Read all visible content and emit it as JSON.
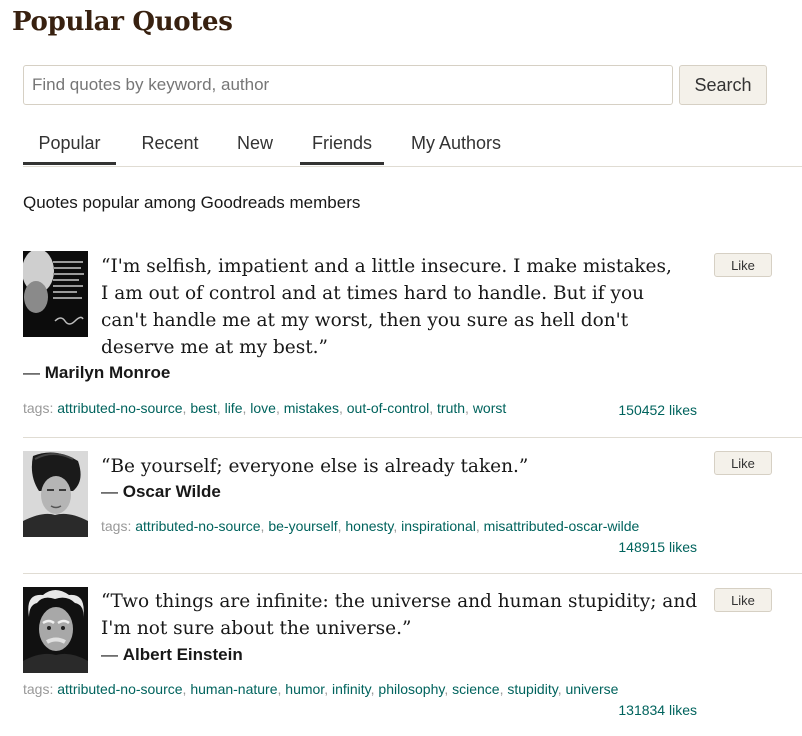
{
  "page": {
    "title": "Popular Quotes",
    "subheading": "Quotes popular among Goodreads members"
  },
  "search": {
    "placeholder": "Find quotes by keyword, author",
    "value": "",
    "button_label": "Search"
  },
  "tabs": [
    {
      "label": "Popular",
      "active": true
    },
    {
      "label": "Recent",
      "active": false
    },
    {
      "label": "New",
      "active": false
    },
    {
      "label": "Friends",
      "active": true
    },
    {
      "label": "My Authors",
      "active": false
    }
  ],
  "quotes": [
    {
      "text": "“I'm selfish, impatient and a little insecure. I make mistakes, I am out of control and at times hard to handle. But if you can't handle me at my worst, then you sure as hell don't deserve me at my best.”",
      "dash": "―",
      "author": "Marilyn Monroe",
      "like_label": "Like",
      "tags_label": "tags:",
      "tags": [
        "attributed-no-source",
        "best",
        "life",
        "love",
        "mistakes",
        "out-of-control",
        "truth",
        "worst"
      ],
      "likes": "150452 likes",
      "image_icon": "marilyn-monroe-photo"
    },
    {
      "text": "“Be yourself; everyone else is already taken.”",
      "dash": "―",
      "author": "Oscar Wilde",
      "like_label": "Like",
      "tags_label": "tags:",
      "tags": [
        "attributed-no-source",
        "be-yourself",
        "honesty",
        "inspirational",
        "misattributed-oscar-wilde"
      ],
      "likes": "148915 likes",
      "image_icon": "oscar-wilde-photo"
    },
    {
      "text": "“Two things are infinite: the universe and human stupidity; and I'm not sure about the universe.”",
      "dash": "―",
      "author": "Albert Einstein",
      "like_label": "Like",
      "tags_label": "tags:",
      "tags": [
        "attributed-no-source",
        "human-nature",
        "humor",
        "infinity",
        "philosophy",
        "science",
        "stupidity",
        "universe"
      ],
      "likes": "131834 likes",
      "image_icon": "albert-einstein-photo"
    }
  ],
  "colors": {
    "title": "#382110",
    "link": "#00635d",
    "button_bg": "#f4f1ea",
    "border": "#d6d0c4"
  }
}
